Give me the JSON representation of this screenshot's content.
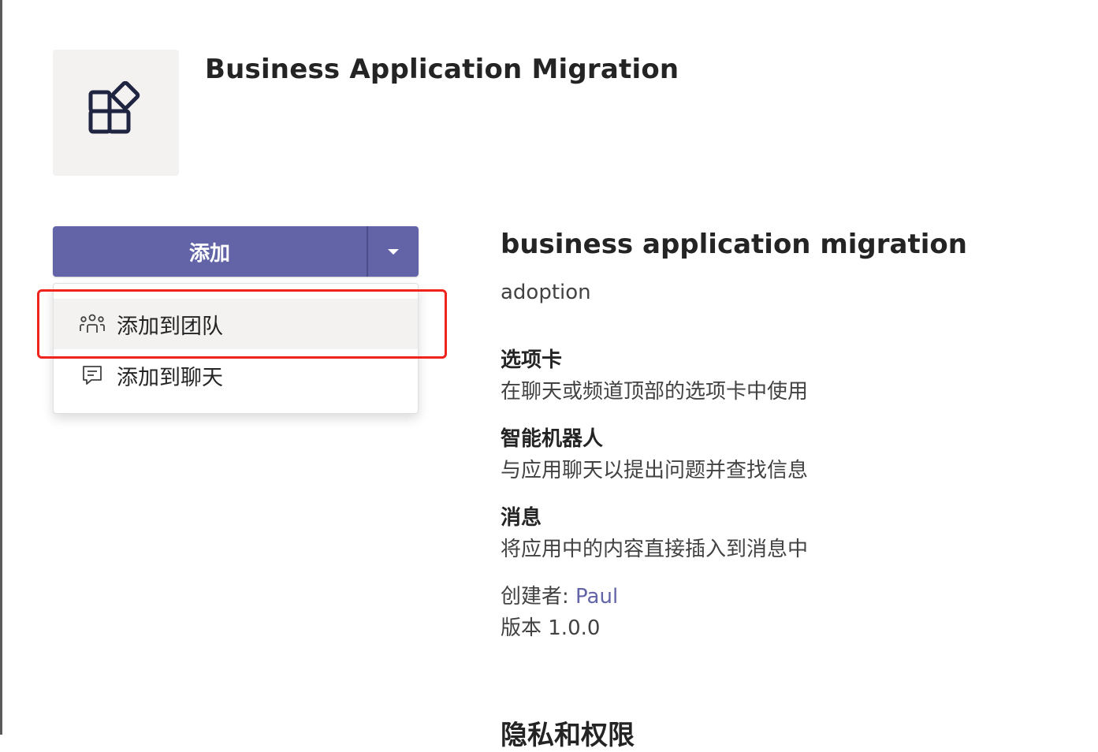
{
  "app": {
    "title": "Business Application Migration",
    "icon": "apps-icon"
  },
  "add_button": {
    "label": "添加",
    "caret_icon": "chevron-down-icon",
    "color": "#6264a7"
  },
  "add_menu": {
    "items": [
      {
        "label": "添加到团队",
        "icon": "team-icon",
        "highlighted": true
      },
      {
        "label": "添加到聊天",
        "icon": "chat-icon",
        "highlighted": false
      }
    ],
    "highlight_color": "#f0241d"
  },
  "details": {
    "heading": "business application migration",
    "subtitle": "adoption",
    "capabilities": [
      {
        "title": "选项卡",
        "description": "在聊天或频道顶部的选项卡中使用"
      },
      {
        "title": "智能机器人",
        "description": "与应用聊天以提出问题并查找信息"
      },
      {
        "title": "消息",
        "description": "将应用中的内容直接插入到消息中"
      }
    ],
    "creator_label": "创建者: ",
    "creator_name": "Paul",
    "version_text": "版本 1.0.0",
    "privacy_heading": "隐私和权限"
  }
}
